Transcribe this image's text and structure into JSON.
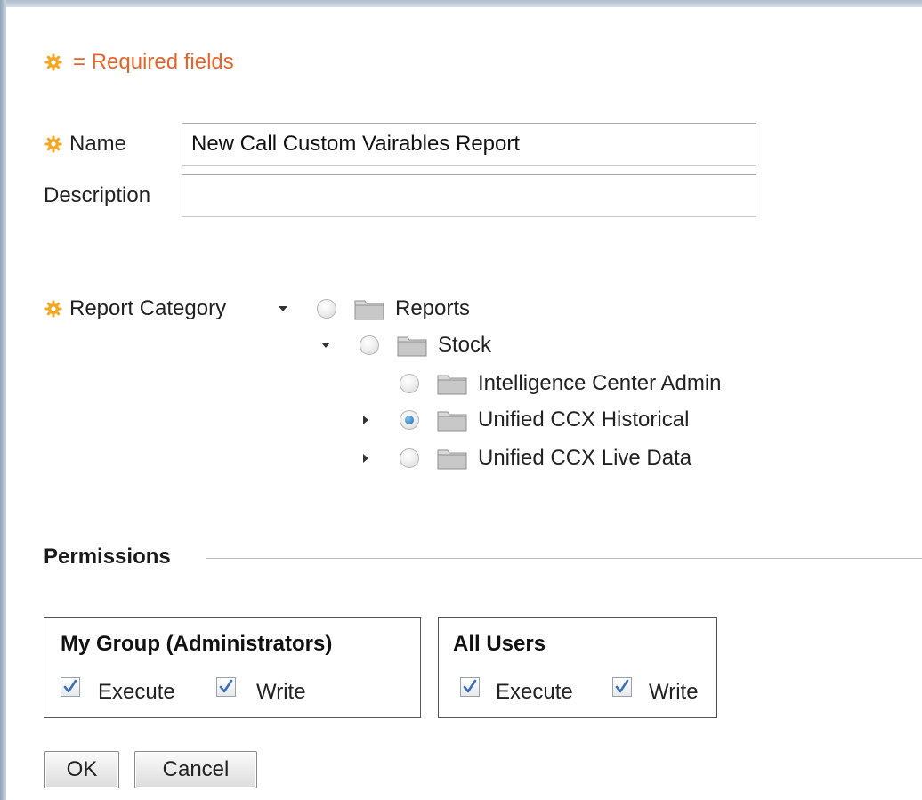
{
  "form": {
    "required_legend": "= Required fields",
    "name_label": "Name",
    "name_value": "New Call Custom Vairables Report",
    "description_label": "Description",
    "description_value": "",
    "category_label": "Report Category"
  },
  "tree": {
    "nodes": [
      {
        "label": "Reports",
        "expanded": true,
        "selected": false
      },
      {
        "label": "Stock",
        "expanded": true,
        "selected": false
      },
      {
        "label": "Intelligence Center Admin",
        "expanded": false,
        "selected": false
      },
      {
        "label": "Unified CCX Historical",
        "expanded": false,
        "selected": true
      },
      {
        "label": "Unified CCX Live Data",
        "expanded": false,
        "selected": false
      }
    ]
  },
  "permissions": {
    "title": "Permissions",
    "my_group": {
      "title": "My Group (Administrators)",
      "execute_label": "Execute",
      "execute_checked": true,
      "write_label": "Write",
      "write_checked": true
    },
    "all_users": {
      "title": "All Users",
      "execute_label": "Execute",
      "execute_checked": true,
      "write_label": "Write",
      "write_checked": true
    }
  },
  "buttons": {
    "ok": "OK",
    "cancel": "Cancel"
  },
  "colors": {
    "required": "#e8642a",
    "gear": "#f5a623",
    "radio_selected": "#1f6aa8"
  },
  "icons": [
    "gear-icon",
    "folder-icon",
    "expand-arrow-icon",
    "collapse-arrow-icon",
    "checkmark-icon"
  ]
}
